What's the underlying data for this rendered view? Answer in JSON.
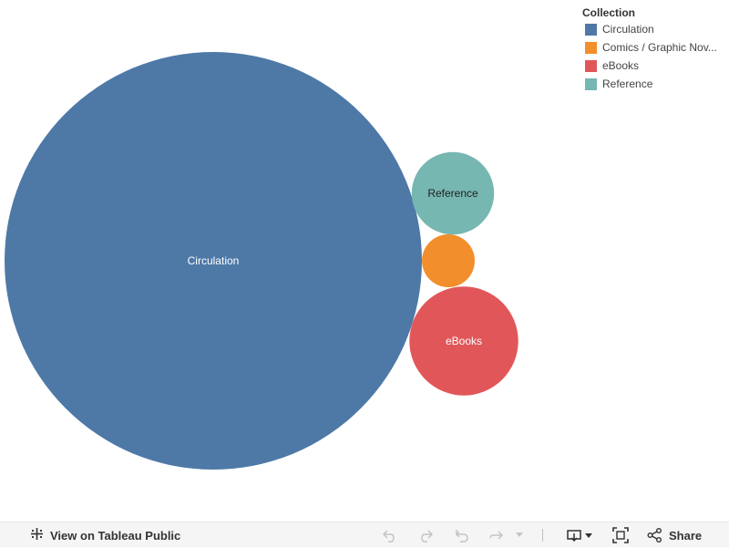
{
  "chart_data": {
    "type": "bubble",
    "legend": {
      "title": "Collection",
      "position": "top-right",
      "items": [
        {
          "label": "Circulation",
          "color": "#4e79a7"
        },
        {
          "label": "Comics / Graphic Nov...",
          "color": "#f28e2b"
        },
        {
          "label": "eBooks",
          "color": "#e15759"
        },
        {
          "label": "Reference",
          "color": "#76b7b2"
        }
      ]
    },
    "bubbles": [
      {
        "name": "Circulation",
        "value": 100,
        "color": "#4e79a7",
        "label": "Circulation",
        "label_color": "#ffffff"
      },
      {
        "name": "eBooks",
        "value": 6.8,
        "color": "#e15759",
        "label": "eBooks",
        "label_color": "#ffffff"
      },
      {
        "name": "Reference",
        "value": 3.9,
        "color": "#76b7b2",
        "label": "Reference",
        "label_color": "#222222"
      },
      {
        "name": "Comics / Graphic Novels",
        "value": 1.6,
        "color": "#f28e2b",
        "label": "",
        "label_color": "#ffffff"
      }
    ]
  },
  "toolbar": {
    "view_label": "View on Tableau Public",
    "share_label": "Share",
    "icons": [
      "tableau-logo-icon",
      "undo-icon",
      "redo-icon",
      "revert-icon",
      "refresh-icon",
      "dropdown-arrow-icon",
      "download-icon",
      "fullscreen-icon",
      "share-icon"
    ]
  }
}
